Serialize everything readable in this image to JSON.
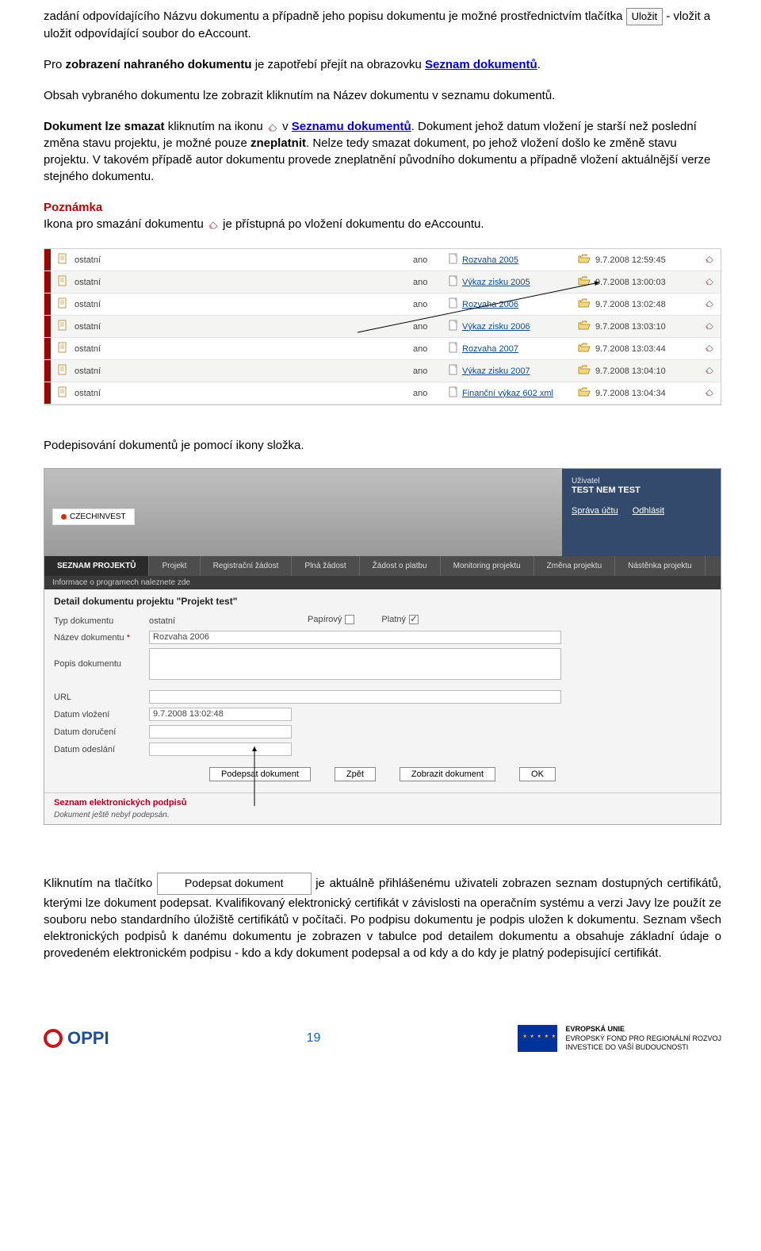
{
  "intro": {
    "p1a": "zadání odpovídajícího Názvu dokumentu a případně jeho popisu dokumentu  je možné prostřednictvím tlačítka ",
    "ulozit": "Uložit",
    "p1b": " - vložit a uložit odpovídající soubor do eAccount.",
    "p2a": "Pro ",
    "p2b": "zobrazení nahraného dokumentu",
    "p2c": " je zapotřebí přejít na obrazovku ",
    "p2link": "Seznam dokumentů",
    "p2d": ".",
    "p3": "Obsah vybraného dokumentu lze zobrazit kliknutím na Název dokumentu v seznamu dokumentů.",
    "p4a": "Dokument lze smazat",
    "p4b": " kliknutím na ikonu ",
    "p4c": "v ",
    "p4link": "Seznamu dokumentů",
    "p4d": ". Dokument jehož datum vložení je starší než poslední změna stavu projektu, je možné pouze ",
    "p4e": "zneplatnit",
    "p4f": ". Nelze tedy smazat dokument, po jehož vložení došlo ke změně stavu projektu. V takovém případě autor dokumentu provede zneplatnění původního dokumentu a případně vložení aktuálnější verze stejného dokumentu.",
    "pozn_label": "Poznámka",
    "pozn_text_a": "Ikona pro smazání dokumentu ",
    "pozn_text_b": "je přístupná po vložení dokumentu do eAccountu."
  },
  "table": {
    "rows": [
      {
        "type": "ostatní",
        "ano": "ano",
        "name": "Rozvaha 2005",
        "date": "9.7.2008 12:59:45"
      },
      {
        "type": "ostatní",
        "ano": "ano",
        "name": "Výkaz zisku 2005",
        "date": "9.7.2008 13:00:03"
      },
      {
        "type": "ostatní",
        "ano": "ano",
        "name": "Rozvaha 2006",
        "date": "9.7.2008 13:02:48"
      },
      {
        "type": "ostatní",
        "ano": "ano",
        "name": "Výkaz zisku 2006",
        "date": "9.7.2008 13:03:10"
      },
      {
        "type": "ostatní",
        "ano": "ano",
        "name": "Rozvaha 2007",
        "date": "9.7.2008 13:03:44"
      },
      {
        "type": "ostatní",
        "ano": "ano",
        "name": "Výkaz zisku 2007",
        "date": "9.7.2008 13:04:10"
      },
      {
        "type": "ostatní",
        "ano": "ano",
        "name": "Finanční výkaz 602 xml",
        "date": "9.7.2008 13:04:34"
      }
    ]
  },
  "section2_title": "Podepisování dokumentů je pomocí ikony složka.",
  "app": {
    "logo": "CZECHINVEST",
    "user_label": "Uživatel",
    "user_name": "TEST NEM TEST",
    "link_account": "Správa účtu",
    "link_logout": "Odhlásit",
    "nav": [
      "SEZNAM PROJEKTŮ",
      "Projekt",
      "Registrační žádost",
      "Plná žádost",
      "Žádost o platbu",
      "Monitoring projektu",
      "Změna projektu",
      "Nástěnka projektu"
    ],
    "subnote": "Informace o programech naleznete zde",
    "detail_title": "Detail dokumentu projektu  \"Projekt test\"",
    "fields": {
      "typ_label": "Typ dokumentu",
      "typ_value": "ostatní",
      "papirovy_label": "Papírový",
      "platny_label": "Platný",
      "nazev_label": "Název dokumentu",
      "nazev_value": "Rozvaha 2006",
      "popis_label": "Popis dokumentu",
      "popis_value": "",
      "url_label": "URL",
      "url_value": "",
      "datum_vlozeni_label": "Datum vložení",
      "datum_vlozeni_value": "9.7.2008 13:02:48",
      "datum_doruceni_label": "Datum doručení",
      "datum_doruceni_value": "",
      "datum_odeslani_label": "Datum odeslání",
      "datum_odeslani_value": ""
    },
    "buttons": {
      "podepsat": "Podepsat dokument",
      "zpet": "Zpět",
      "zobrazit": "Zobrazit dokument",
      "ok": "OK"
    },
    "sig_title": "Seznam elektronických podpisů",
    "sig_note": "Dokument ještě nebyl podepsán."
  },
  "closing": {
    "a": "Kliknutím  na  tlačítko  ",
    "btn": "Podepsat dokument",
    "b": "je  aktuálně  přihlášenému  uživateli  zobrazen seznam dostupných certifikátů, kterými lze dokument podepsat. Kvalifikovaný elektronický certifikát v závislosti  na  operačním  systému  a  verzi  Javy  lze  použít  ze  souboru  nebo  standardního  úložiště certifikátů  v  počítači.  Po  podpisu  dokumentu  je  podpis  uložen  k  dokumentu.  Seznam  všech elektronických  podpisů  k  danému  dokumentu  je  zobrazen  v  tabulce  pod  detailem  dokumentu  a obsahuje základní údaje o provedeném elektronickém podpisu - kdo a kdy dokument podepsal a od kdy a do kdy je platný podepisující certifikát."
  },
  "footer": {
    "oppi": "OPPI",
    "page": "19",
    "eu1": "EVROPSKÁ UNIE",
    "eu2": "EVROPSKÝ FOND PRO REGIONÁLNÍ ROZVOJ",
    "eu3": "INVESTICE DO VAŠÍ BUDOUCNOSTI"
  }
}
